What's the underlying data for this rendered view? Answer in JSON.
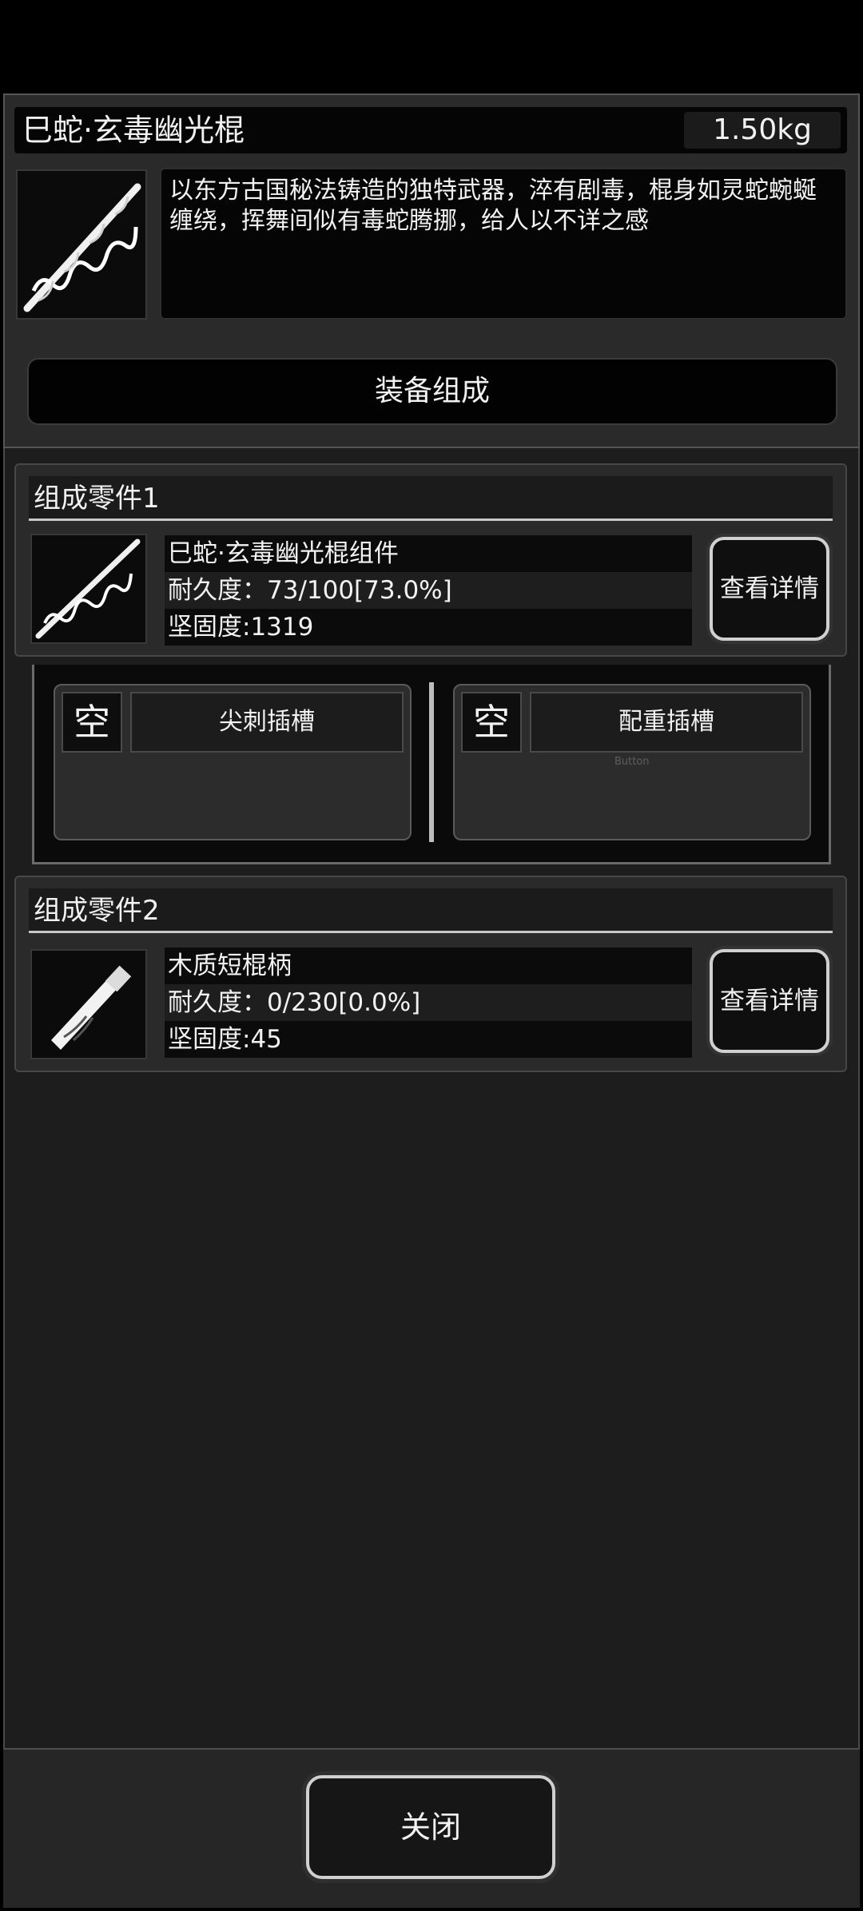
{
  "item": {
    "name": "巳蛇·玄毒幽光棍",
    "weight": "1.50kg",
    "description": "以东方古国秘法铸造的独特武器，淬有剧毒，棍身如灵蛇蜿蜒缠绕，挥舞间似有毒蛇腾挪，给人以不详之感",
    "icon": "serpent-staff-icon"
  },
  "composition_button": "装备组成",
  "parts": [
    {
      "title": "组成零件1",
      "name": "巳蛇·玄毒幽光棍组件",
      "durability": "耐久度：73/100[73.0%]",
      "hardness": "坚固度:1319",
      "detail_button": "查看详情",
      "icon": "serpent-staff-icon"
    },
    {
      "title": "组成零件2",
      "name": "木质短棍柄",
      "durability": "耐久度：0/230[0.0%]",
      "hardness": "坚固度:45",
      "detail_button": "查看详情",
      "icon": "wooden-handle-icon"
    }
  ],
  "slots": [
    {
      "empty": "空",
      "label": "尖刺插槽"
    },
    {
      "empty": "空",
      "label": "配重插槽",
      "ghost": "Button"
    }
  ],
  "close_button": "关闭",
  "colors": {
    "background": "#1d1d1d",
    "panel": "#2a2a2a",
    "text": "#f2f2f2",
    "button_border": "#d0d0d0"
  }
}
